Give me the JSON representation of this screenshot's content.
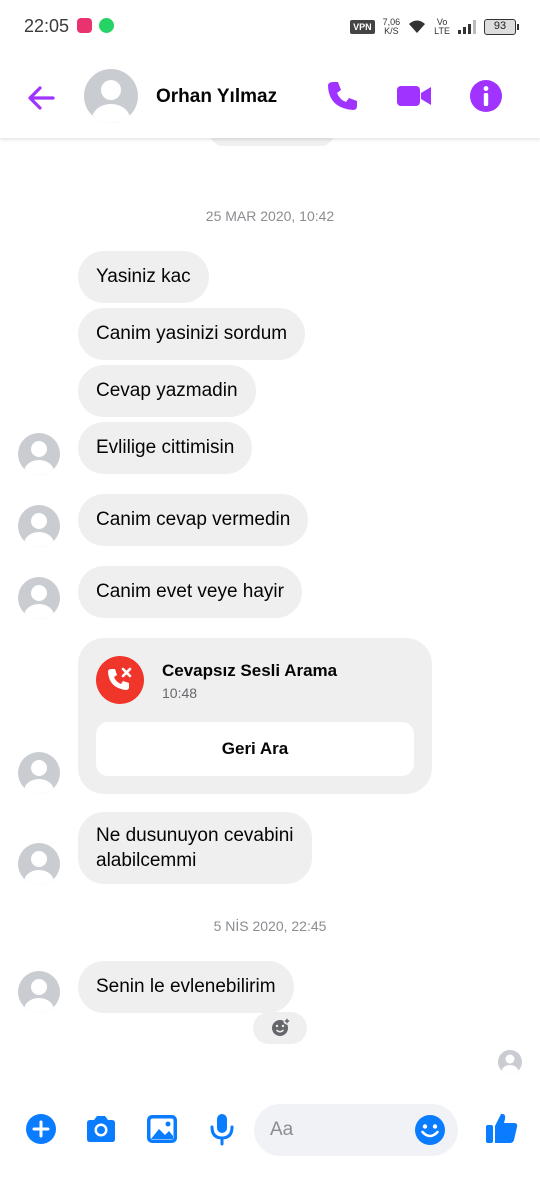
{
  "status_bar": {
    "time": "22:05",
    "vpn": "VPN",
    "speed_value": "7,06",
    "speed_unit": "K/S",
    "volte_top": "Vo",
    "volte_bottom": "LTE",
    "battery": "93"
  },
  "header": {
    "contact_name": "Orhan Yılmaz",
    "accent_color": "#a033ff"
  },
  "conversation": {
    "date_1": "25 MAR 2020, 10:42",
    "messages": [
      "Yasiniz kac",
      "Canim yasinizi sordum",
      "Cevap yazmadin",
      "Evlilige cittimisin",
      "Canim cevap vermedin",
      "Canim evet veye hayir"
    ],
    "missed_call": {
      "title": "Cevapsız Sesli Arama",
      "time": "10:48",
      "button": "Geri Ara"
    },
    "message_after_call_line1": "Ne dusunuyon cevabini",
    "message_after_call_line2": "alabilcemmi",
    "date_2": "5 NİS 2020, 22:45",
    "last_message": "Senin le evlenebilirim"
  },
  "composer": {
    "placeholder": "Aa",
    "icon_color": "#0a7cff"
  }
}
